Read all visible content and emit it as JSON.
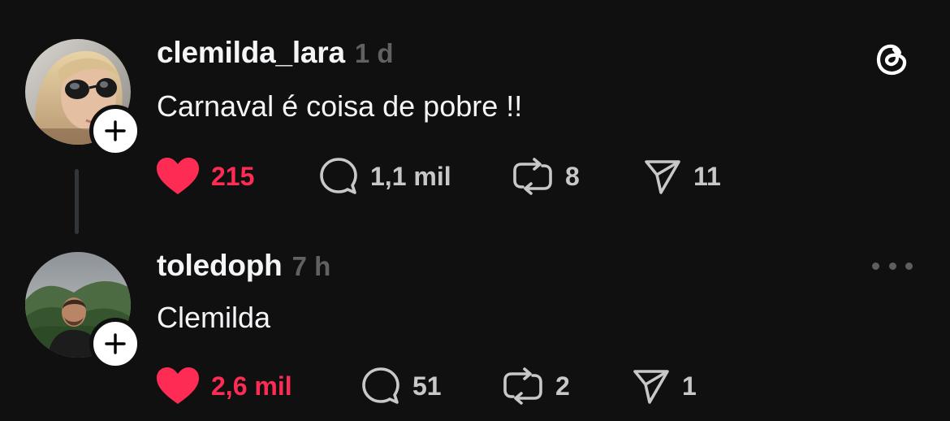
{
  "posts": [
    {
      "username": "clemilda_lara",
      "time": "1 d",
      "text": "Carnaval é coisa de pobre !!",
      "likes": "215",
      "comments": "1,1 mil",
      "reposts": "8",
      "shares": "11",
      "liked": true
    },
    {
      "username": "toledoph",
      "time": "7 h",
      "text": "Clemilda",
      "likes": "2,6 mil",
      "comments": "51",
      "reposts": "2",
      "shares": "1",
      "liked": true
    }
  ],
  "icons": {
    "app_logo": "threads-logo-icon",
    "more": "more-options-icon",
    "like": "heart-icon",
    "comment": "comment-icon",
    "repost": "repost-icon",
    "share": "send-icon",
    "follow": "plus-icon"
  },
  "colors": {
    "background": "#101010",
    "text": "#f3f5f7",
    "muted": "#616161",
    "like": "#fe2c55",
    "counts": "#c8c8c8"
  }
}
